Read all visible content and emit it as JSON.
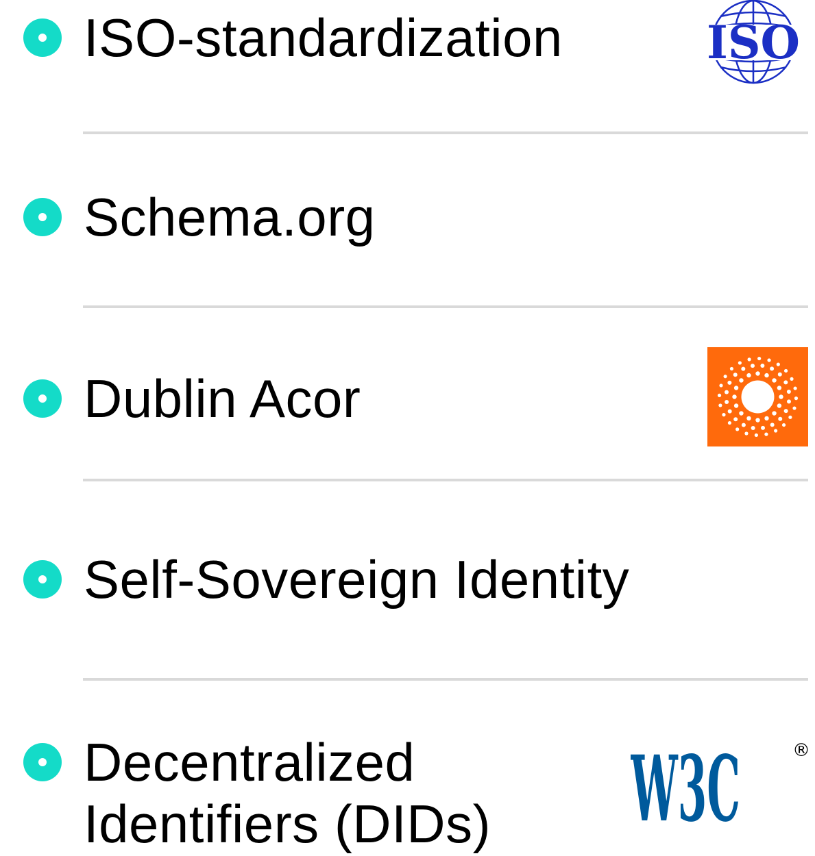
{
  "items": [
    {
      "label": "ISO-standardization",
      "logo": "iso-logo"
    },
    {
      "label": "Schema.org",
      "logo": null
    },
    {
      "label": "Dublin Acor",
      "logo": "dublin-core-logo"
    },
    {
      "label": "Self-Sovereign Identity",
      "logo": null
    },
    {
      "label_line1": "Decentralized",
      "label_line2": "Identifiers (DIDs)",
      "logo": "w3c-logo"
    }
  ],
  "logos": {
    "iso": {
      "text": "ISO"
    },
    "w3c": {
      "text": "W3C",
      "mark": "®"
    }
  },
  "colors": {
    "bullet": "#14dbc8",
    "divider": "#d9d9d9",
    "iso_blue": "#1b2fc4",
    "dublin_orange": "#ff6a0c",
    "w3c_blue": "#005a9c"
  }
}
